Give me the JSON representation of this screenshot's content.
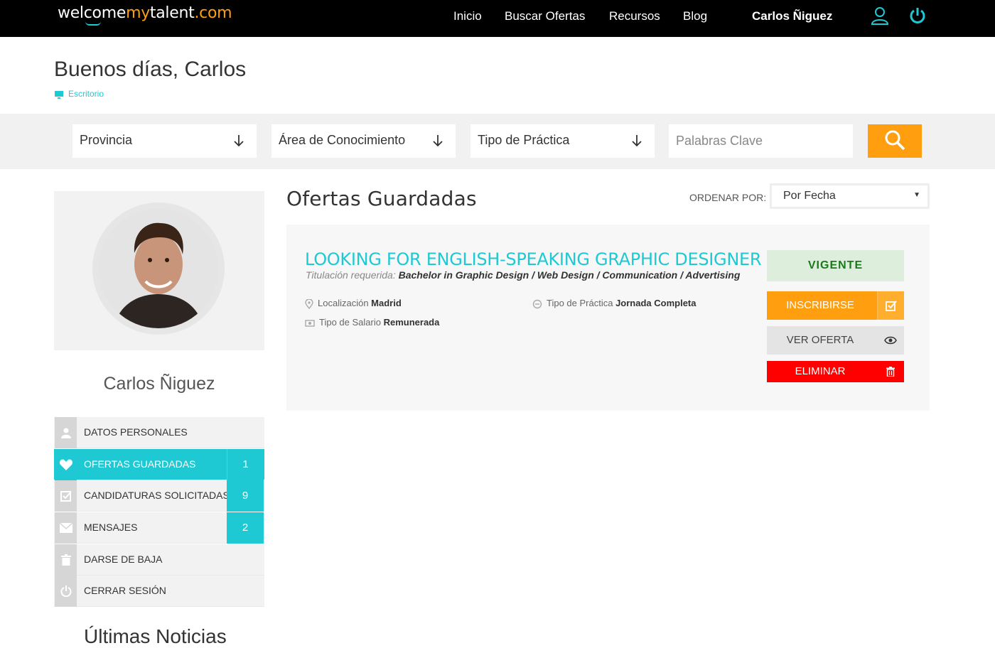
{
  "brand": {
    "part1": "welcome",
    "part2": "my",
    "part3": "talent",
    "part4": ".com"
  },
  "nav": {
    "items": [
      "Inicio",
      "Buscar Ofertas",
      "Recursos",
      "Blog"
    ],
    "user": "Carlos Ñiguez"
  },
  "greeting": "Buenos días, Carlos",
  "breadcrumb": "Escritorio",
  "search": {
    "province": "Provincia",
    "area": "Área de Conocimiento",
    "type": "Tipo de Práctica",
    "keywords_placeholder": "Palabras Clave"
  },
  "profile": {
    "name": "Carlos Ñiguez"
  },
  "menu": [
    {
      "label": "DATOS PERSONALES",
      "icon": "user-icon",
      "badge": ""
    },
    {
      "label": "OFERTAS GUARDADAS",
      "icon": "heart-icon",
      "badge": "1",
      "active": true
    },
    {
      "label": "CANDIDATURAS SOLICITADAS",
      "icon": "checkbox-icon",
      "badge": "9"
    },
    {
      "label": "MENSAJES",
      "icon": "envelope-icon",
      "badge": "2"
    },
    {
      "label": "DARSE DE BAJA",
      "icon": "trash-icon",
      "badge": ""
    },
    {
      "label": "CERRAR SESIÓN",
      "icon": "power-icon",
      "badge": ""
    }
  ],
  "news_title": "Últimas Noticias",
  "main": {
    "title": "Ofertas Guardadas",
    "order_label": "ORDENAR POR:",
    "order_value": "Por Fecha"
  },
  "offer": {
    "title": "LOOKING FOR ENGLISH-SPEAKING GRAPHIC DESIGNER",
    "req_label": "Titulación requerida:",
    "req_value": "Bachelor in Graphic Design / Web Design / Communication / Advertising",
    "location_label": "Localización",
    "location_value": "Madrid",
    "type_label": "Tipo de Práctica",
    "type_value": "Jornada Completa",
    "salary_label": "Tipo de Salario",
    "salary_value": "Remunerada",
    "status": "VIGENTE",
    "apply": "INSCRIBIRSE",
    "view": "VER OFERTA",
    "delete": "ELIMINAR"
  },
  "colors": {
    "accent": "#1ec9d3",
    "orange": "#ff9f0f",
    "red": "#ff0000",
    "status_bg": "#ddeedd",
    "status_text": "#1a7a1a"
  }
}
